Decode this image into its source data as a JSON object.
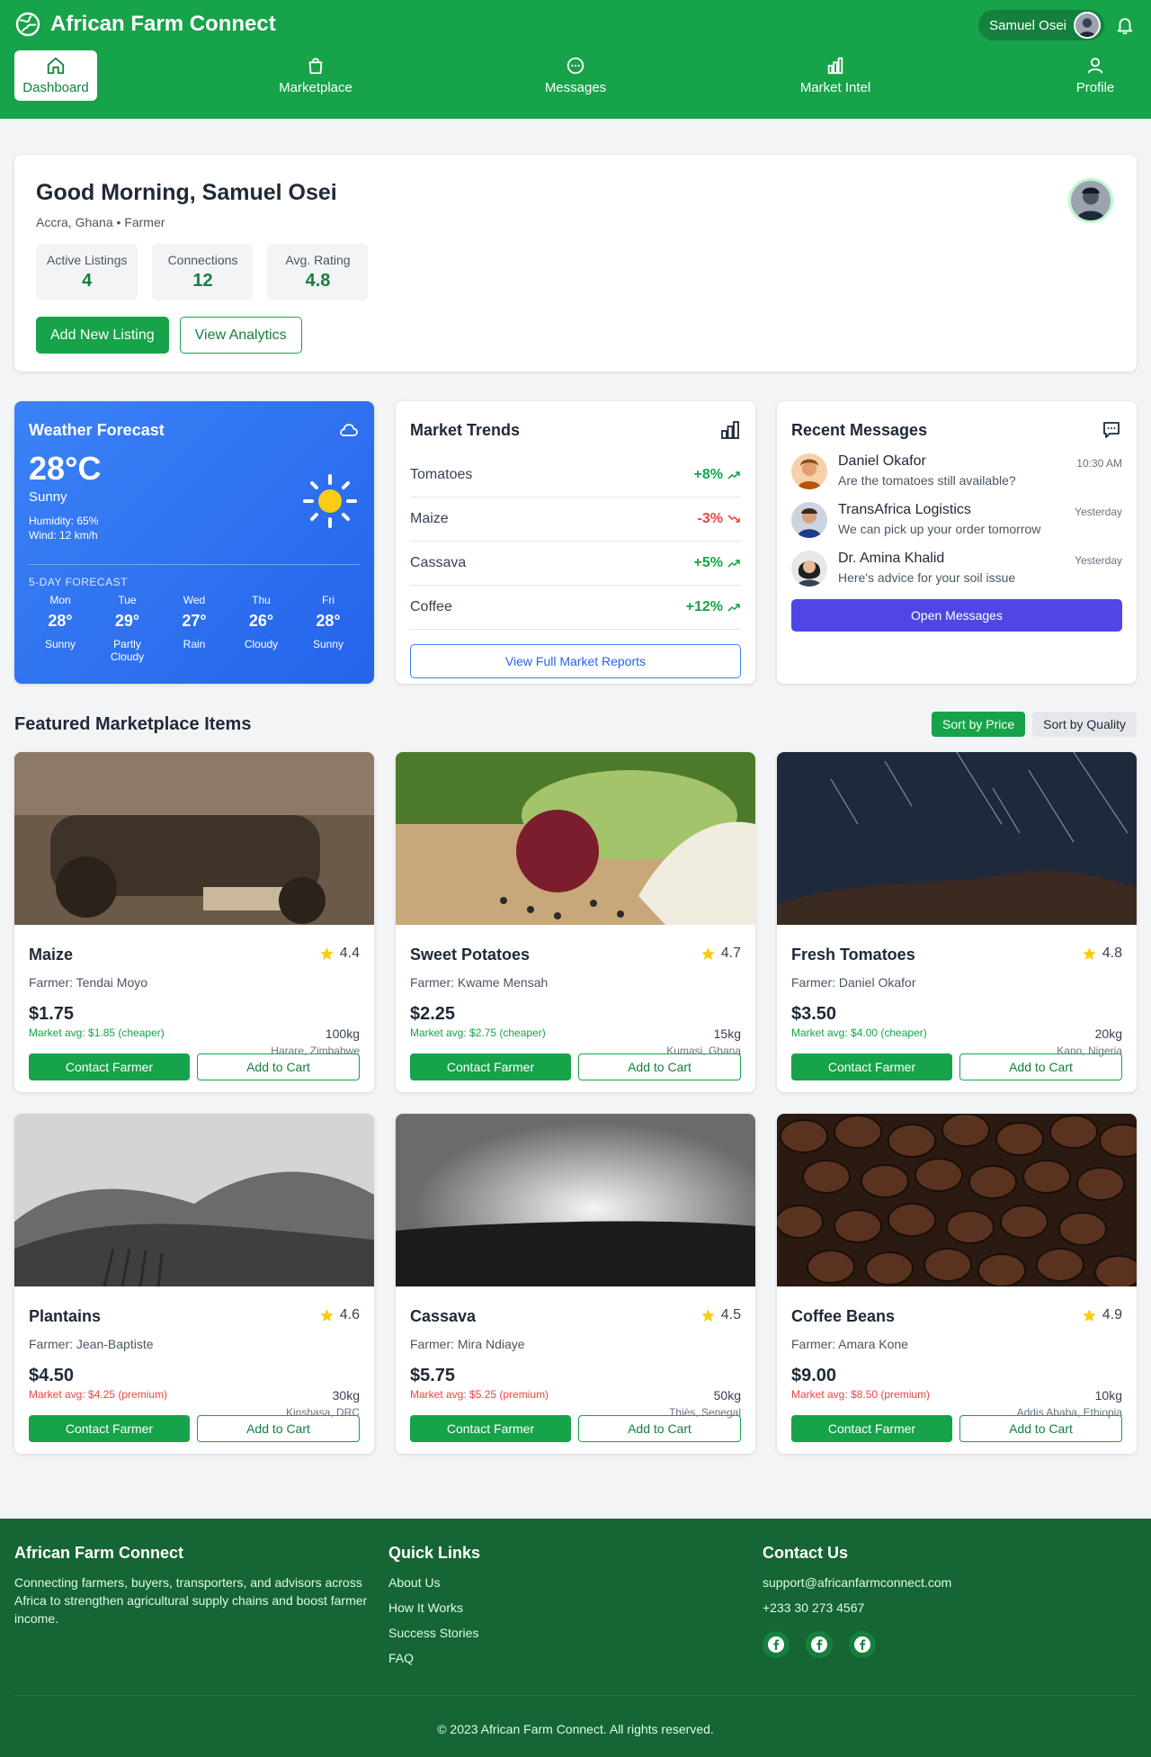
{
  "header": {
    "app_title": "African Farm Connect",
    "user_name": "Samuel Osei",
    "nav": [
      {
        "label": "Dashboard",
        "icon": "home-icon",
        "active": true
      },
      {
        "label": "Marketplace",
        "icon": "shopping-bag-icon",
        "active": false
      },
      {
        "label": "Messages",
        "icon": "chat-bubble-icon",
        "active": false
      },
      {
        "label": "Market Intel",
        "icon": "bar-chart-icon",
        "active": false
      },
      {
        "label": "Profile",
        "icon": "user-icon",
        "active": false
      }
    ]
  },
  "welcome": {
    "greeting": "Good Morning, Samuel Osei",
    "subtitle": "Accra, Ghana • Farmer",
    "stats": [
      {
        "label": "Active Listings",
        "value": "4"
      },
      {
        "label": "Connections",
        "value": "12"
      },
      {
        "label": "Avg. Rating",
        "value": "4.8"
      }
    ],
    "add_listing_label": "Add New Listing",
    "view_analytics_label": "View Analytics"
  },
  "weather": {
    "title": "Weather Forecast",
    "temp": "28°C",
    "condition": "Sunny",
    "humidity": "Humidity: 65%",
    "wind": "Wind: 12 km/h",
    "forecast_title": "5-DAY FORECAST",
    "forecast": [
      {
        "day": "Mon",
        "temp": "28°",
        "cond": "Sunny"
      },
      {
        "day": "Tue",
        "temp": "29°",
        "cond": "Partly Cloudy"
      },
      {
        "day": "Wed",
        "temp": "27°",
        "cond": "Rain"
      },
      {
        "day": "Thu",
        "temp": "26°",
        "cond": "Cloudy"
      },
      {
        "day": "Fri",
        "temp": "28°",
        "cond": "Sunny"
      }
    ]
  },
  "trends": {
    "title": "Market Trends",
    "items": [
      {
        "name": "Tomatoes",
        "change": "+8%",
        "dir": "up"
      },
      {
        "name": "Maize",
        "change": "-3%",
        "dir": "down"
      },
      {
        "name": "Cassava",
        "change": "+5%",
        "dir": "up"
      },
      {
        "name": "Coffee",
        "change": "+12%",
        "dir": "up"
      }
    ],
    "button_label": "View Full Market Reports"
  },
  "messages": {
    "title": "Recent Messages",
    "items": [
      {
        "name": "Daniel Okafor",
        "text": "Are the tomatoes still available?",
        "time": "10:30 AM"
      },
      {
        "name": "TransAfrica Logistics",
        "text": "We can pick up your order tomorrow",
        "time": "Yesterday"
      },
      {
        "name": "Dr. Amina Khalid",
        "text": "Here's advice for your soil issue",
        "time": "Yesterday"
      }
    ],
    "button_label": "Open Messages"
  },
  "featured": {
    "title": "Featured Marketplace Items",
    "sort_price_label": "Sort by Price",
    "sort_quality_label": "Sort by Quality",
    "contact_label": "Contact Farmer",
    "cart_label": "Add to Cart",
    "products": [
      {
        "name": "Maize",
        "rating": "4.4",
        "farmer": "Farmer: Tendai Moyo",
        "price": "$1.75",
        "qty": "100kg",
        "avg": "Market avg: $1.85 (cheaper)",
        "avg_type": "cheap",
        "location": "Harare, Zimbabwe"
      },
      {
        "name": "Sweet Potatoes",
        "rating": "4.7",
        "farmer": "Farmer: Kwame Mensah",
        "price": "$2.25",
        "qty": "15kg",
        "avg": "Market avg: $2.75 (cheaper)",
        "avg_type": "cheap",
        "location": "Kumasi, Ghana"
      },
      {
        "name": "Fresh Tomatoes",
        "rating": "4.8",
        "farmer": "Farmer: Daniel Okafor",
        "price": "$3.50",
        "qty": "20kg",
        "avg": "Market avg: $4.00 (cheaper)",
        "avg_type": "cheap",
        "location": "Kano, Nigeria"
      },
      {
        "name": "Plantains",
        "rating": "4.6",
        "farmer": "Farmer: Jean-Baptiste",
        "price": "$4.50",
        "qty": "30kg",
        "avg": "Market avg: $4.25 (premium)",
        "avg_type": "prem",
        "location": "Kinshasa, DRC"
      },
      {
        "name": "Cassava",
        "rating": "4.5",
        "farmer": "Farmer: Mira Ndiaye",
        "price": "$5.75",
        "qty": "50kg",
        "avg": "Market avg: $5.25 (premium)",
        "avg_type": "prem",
        "location": "Thiès, Senegal"
      },
      {
        "name": "Coffee Beans",
        "rating": "4.9",
        "farmer": "Farmer: Amara Kone",
        "price": "$9.00",
        "qty": "10kg",
        "avg": "Market avg: $8.50 (premium)",
        "avg_type": "prem",
        "location": "Addis Ababa, Ethiopia"
      }
    ]
  },
  "footer": {
    "about_title": "African Farm Connect",
    "about_text": "Connecting farmers, buyers, transporters, and advisors across Africa to strengthen agricultural supply chains and boost farmer income.",
    "links_title": "Quick Links",
    "links": [
      "About Us",
      "How It Works",
      "Success Stories",
      "FAQ"
    ],
    "contact_title": "Contact Us",
    "email": "support@africanfarmconnect.com",
    "phone": "+233 30 273 4567",
    "copyright": "© 2023 African Farm Connect. All rights reserved."
  },
  "colors": {
    "brand_green": "#16a34a",
    "dark_green": "#166534",
    "weather_blue": "#2563eb",
    "indigo": "#4f46e5",
    "negative": "#ef4444"
  }
}
